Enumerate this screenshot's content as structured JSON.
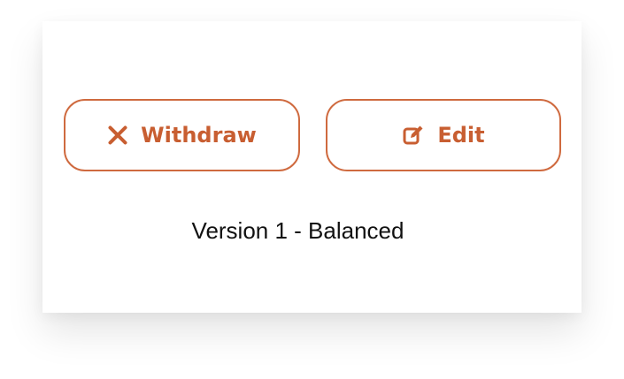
{
  "actions": {
    "withdraw": {
      "label": "Withdraw",
      "icon": "close-icon"
    },
    "edit": {
      "label": "Edit",
      "icon": "edit-icon"
    }
  },
  "version": {
    "label": "Version 1 - Balanced"
  },
  "colors": {
    "accent": "#cf6a3f",
    "text": "#111111",
    "background": "#ffffff"
  }
}
